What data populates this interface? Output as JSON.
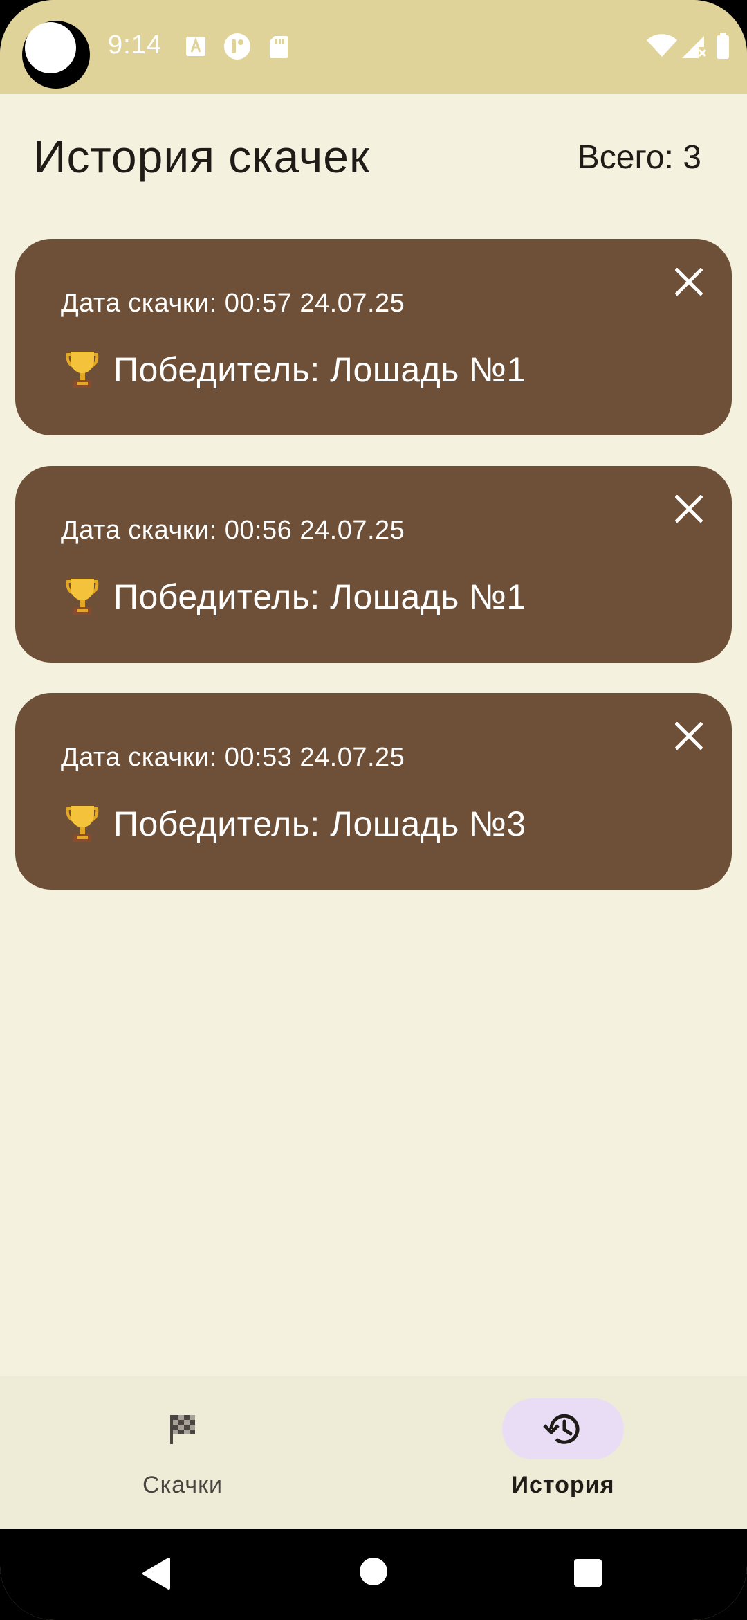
{
  "status_bar": {
    "time": "9:14"
  },
  "header": {
    "title": "История скачек",
    "total": "Всего: 3"
  },
  "races": [
    {
      "date": "Дата скачки: 00:57 24.07.25",
      "winner": "Победитель: Лошадь №1"
    },
    {
      "date": "Дата скачки: 00:56 24.07.25",
      "winner": "Победитель: Лошадь №1"
    },
    {
      "date": "Дата скачки: 00:53 24.07.25",
      "winner": "Победитель: Лошадь №3"
    }
  ],
  "bottom_nav": {
    "races_label": "Скачки",
    "history_label": "История",
    "active": "history"
  },
  "colors": {
    "background": "#F4F1DE",
    "status_bar": "#E0D39A",
    "card": "#6E4F37",
    "nav_active_pill": "#E9DDF6"
  },
  "icons": {
    "card_close": "close-icon",
    "card_trophy": "trophy-icon",
    "nav_races": "checkered-flag-icon",
    "nav_history": "history-icon"
  }
}
